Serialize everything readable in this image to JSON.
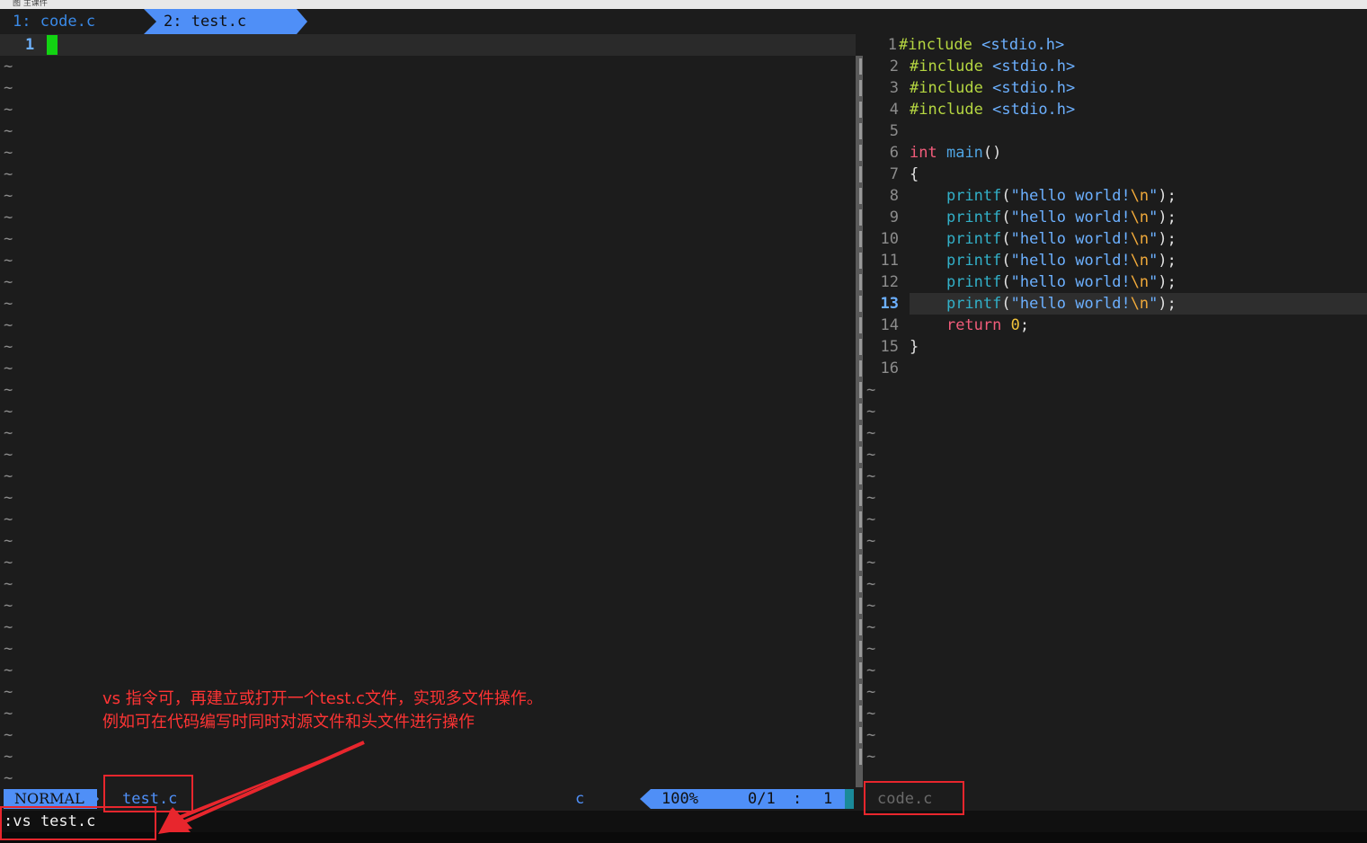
{
  "window": {
    "title": "图 主课件"
  },
  "tabs": [
    {
      "label": "1: code.c",
      "active": false
    },
    {
      "label": "2: test.c",
      "active": true
    }
  ],
  "left_window": {
    "current_line_number": "1",
    "tilde": "~"
  },
  "right_window": {
    "current_line": 13,
    "lines": [
      {
        "n": "1",
        "text": "#include <stdio.h>"
      },
      {
        "n": "2",
        "text": "#include <stdio.h>"
      },
      {
        "n": "3",
        "text": "#include <stdio.h>"
      },
      {
        "n": "4",
        "text": "#include <stdio.h>"
      },
      {
        "n": "5",
        "text": ""
      },
      {
        "n": "6",
        "text": "int main()"
      },
      {
        "n": "7",
        "text": "{"
      },
      {
        "n": "8",
        "text": "    printf(\"hello world!\\n\");"
      },
      {
        "n": "9",
        "text": "    printf(\"hello world!\\n\");"
      },
      {
        "n": "10",
        "text": "    printf(\"hello world!\\n\");"
      },
      {
        "n": "11",
        "text": "    printf(\"hello world!\\n\");"
      },
      {
        "n": "12",
        "text": "    printf(\"hello world!\\n\");"
      },
      {
        "n": "13",
        "text": "    printf(\"hello world!\\n\");"
      },
      {
        "n": "14",
        "text": "    return 0;"
      },
      {
        "n": "15",
        "text": "}"
      },
      {
        "n": "16",
        "text": ""
      }
    ]
  },
  "statusline": {
    "mode": "NORMAL",
    "filename": "test.c",
    "filetype": "c",
    "percent": "100%",
    "lines": "0/1",
    "col_sep": ":",
    "col": "1",
    "right_filename": "code.c"
  },
  "cmdline": ":vs test.c",
  "annotation": {
    "line1": "vs 指令可，再建立或打开一个test.c文件，实现多文件操作。",
    "line2": "例如可在代码编写时同时对源文件和头文件进行操作",
    "color": "#ff3434"
  },
  "colors": {
    "accent": "#4f8ff7",
    "cursor": "#12d312",
    "highlight_red": "#e8262d"
  }
}
